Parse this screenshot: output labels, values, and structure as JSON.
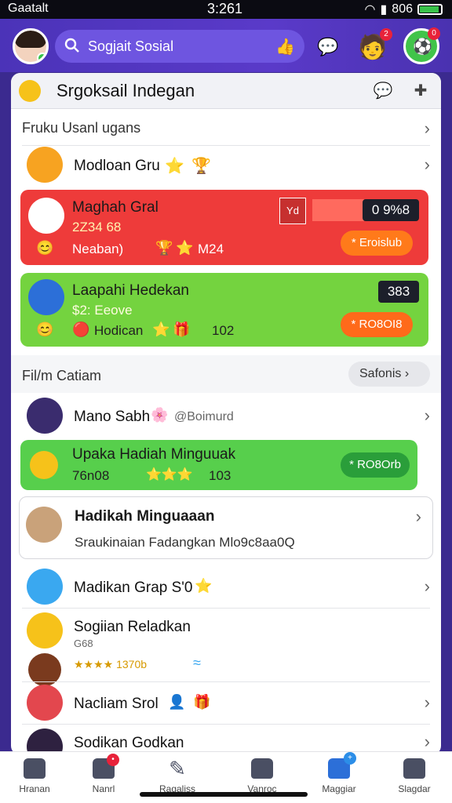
{
  "status": {
    "carrier": "Gaatalt",
    "time": "3:261",
    "battery": "806"
  },
  "search": {
    "text": "Sogjait Sosial"
  },
  "panel": {
    "title": "Srgoksail Indegan",
    "section1_label": "Fruku Usanl ugans",
    "item1": {
      "name": "Modloan Gru"
    },
    "card_red": {
      "name": "Maghah Gral",
      "line2": "2Z34 68",
      "line3": "Neaban) ",
      "line3b": "M24",
      "box_label": "Yd",
      "box_value": "0 9%8",
      "button": "* Eroislub"
    },
    "card_green": {
      "name": "Laapahi Hedekan",
      "line2": "$2: Eeove",
      "line3": "Hodican",
      "line3b": "102",
      "box_value": "383",
      "button": "* RO8OI8"
    },
    "section2_label": "Fil/m Catiam",
    "section2_button": "Safonis",
    "item2": {
      "name": "Mano Sabh",
      "tag": "@Boimurd"
    },
    "card_weekly": {
      "name": "Upaka Hadiah Minguuak",
      "line2": "76n08",
      "line2b": "103",
      "button": "* RO8Orb"
    },
    "card_plain": {
      "name": "Hadikah Minguaaan",
      "sub": "Sraukinaian Fadangkan Mlo9c8aa0Q"
    },
    "item3": {
      "name": "Madikan Grap S'0"
    },
    "item4": {
      "name": "Sogiian Reladkan",
      "sub": "G68",
      "stars": "★★★★ 1370b"
    },
    "item5": {
      "name": "Nacliam Srol"
    },
    "item6": {
      "name": "Sodikan Godkan"
    }
  },
  "nav": [
    {
      "label": "Hranan"
    },
    {
      "label": "Nanrl"
    },
    {
      "label": "Ragaliss"
    },
    {
      "label": "Vanroc"
    },
    {
      "label": "Maggiar"
    },
    {
      "label": "Slagdar"
    }
  ],
  "colors": {
    "accent": "#5a3ac9",
    "red_card": "#ee3b3a",
    "green_card": "#74d33f",
    "orange_btn": "#ff7a1a"
  }
}
